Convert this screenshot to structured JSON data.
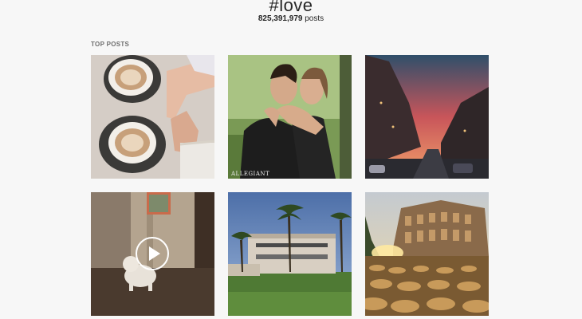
{
  "header": {
    "hashtag": "#love",
    "post_count": "825,391,979",
    "post_suffix": " posts"
  },
  "section": {
    "label": "TOP POSTS"
  },
  "posts": [
    {
      "name": "post-coffee-hands",
      "caption": ""
    },
    {
      "name": "post-couple-embrace",
      "caption": "ALLEGIANT"
    },
    {
      "name": "post-city-street-sunset",
      "caption": ""
    },
    {
      "name": "post-puppy-video",
      "caption": "",
      "is_video": true
    },
    {
      "name": "post-villa-palm-trees",
      "caption": ""
    },
    {
      "name": "post-colosseum-sunset",
      "caption": ""
    }
  ],
  "icons": {
    "video": "play-icon"
  }
}
